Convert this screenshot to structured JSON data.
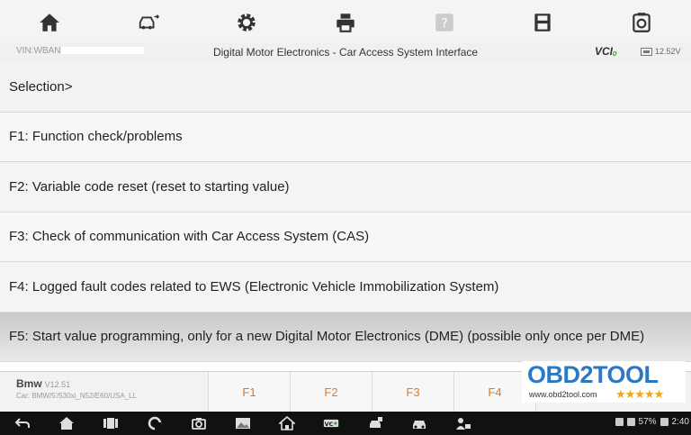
{
  "toolbar": {
    "buttons": [
      {
        "name": "home",
        "icon": "home-icon"
      },
      {
        "name": "vehicle-swap",
        "icon": "car-swap-icon"
      },
      {
        "name": "settings",
        "icon": "gear-icon"
      },
      {
        "name": "print",
        "icon": "printer-icon"
      },
      {
        "name": "help",
        "icon": "help-icon"
      },
      {
        "name": "save",
        "icon": "save-icon"
      },
      {
        "name": "data-logging",
        "icon": "datalog-icon"
      }
    ]
  },
  "infobar": {
    "vin": "VIN:WBAN",
    "title": "Digital Motor Electronics - Car Access System Interface",
    "vci_label": "VCI",
    "battery": "12.52V"
  },
  "list": {
    "header": "Selection>",
    "items": [
      "F1: Function check/problems",
      "F2: Variable code reset (reset to starting value)",
      "F3: Check of communication with Car Access System (CAS)",
      "F4: Logged fault codes related to EWS (Electronic Vehicle Immobilization System)",
      "F5: Start value programming, only for a new Digital Motor Electronics (DME) (possible only once per DME)"
    ]
  },
  "footer": {
    "vehicle_name": "Bmw",
    "version": "V12.51",
    "path": "Car: BMW/5'/530xi_N52/E60/USA_LL",
    "function_keys": [
      "F1",
      "F2",
      "F3",
      "F4"
    ]
  },
  "watermark": {
    "logo": "OBD2TOOL",
    "url": "www.obd2tool.com",
    "stars": "★★★★★"
  },
  "status_bar": {
    "battery": "57%",
    "time": "2:40"
  },
  "colors": {
    "accent": "#e07a22",
    "brand_blue": "#2b78c5",
    "vci_green": "#3aa53a"
  }
}
